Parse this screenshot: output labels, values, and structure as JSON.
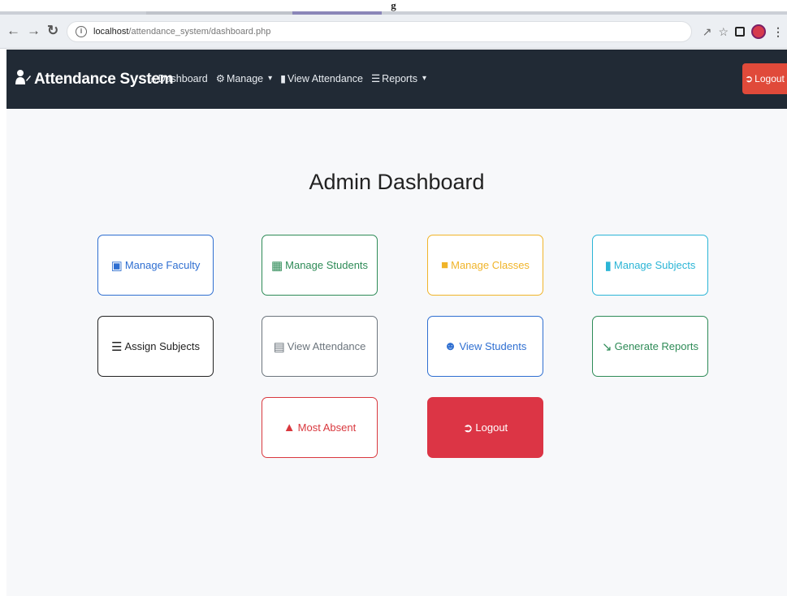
{
  "browser": {
    "url_host": "localhost",
    "url_path": "/attendance_system/dashboard.php"
  },
  "navbar": {
    "brand": "Attendance System",
    "links": [
      {
        "label": "Dashboard",
        "icon": "home-icon"
      },
      {
        "label": "Manage",
        "icon": "gears-icon",
        "dropdown": true
      },
      {
        "label": "View Attendance",
        "icon": "id-badge-icon"
      },
      {
        "label": "Reports",
        "icon": "list-icon",
        "dropdown": true
      }
    ],
    "logout": "Logout"
  },
  "main": {
    "title": "Admin Dashboard",
    "buttons": [
      {
        "label": "Manage Faculty",
        "icon": "chalkboard-icon",
        "color": "#2f6fd1"
      },
      {
        "label": "Manage Students",
        "icon": "graduate-icon",
        "color": "#2e8b57"
      },
      {
        "label": "Manage Classes",
        "icon": "building-icon",
        "color": "#f0b429"
      },
      {
        "label": "Manage Subjects",
        "icon": "book-icon",
        "color": "#2bb5d6"
      },
      {
        "label": "Assign Subjects",
        "icon": "list-icon",
        "color": "#222222"
      },
      {
        "label": "View Attendance",
        "icon": "clipboard-icon",
        "color": "#6c757d"
      },
      {
        "label": "View Students",
        "icon": "users-icon",
        "color": "#2f6fd1"
      },
      {
        "label": "Generate Reports",
        "icon": "chart-line-icon",
        "color": "#2e8b57"
      },
      {
        "label": "Most Absent",
        "icon": "warning-icon",
        "color": "#d9383e"
      },
      {
        "label": "Logout",
        "icon": "logout-icon",
        "color": "#dc3545",
        "filled": true
      }
    ]
  }
}
